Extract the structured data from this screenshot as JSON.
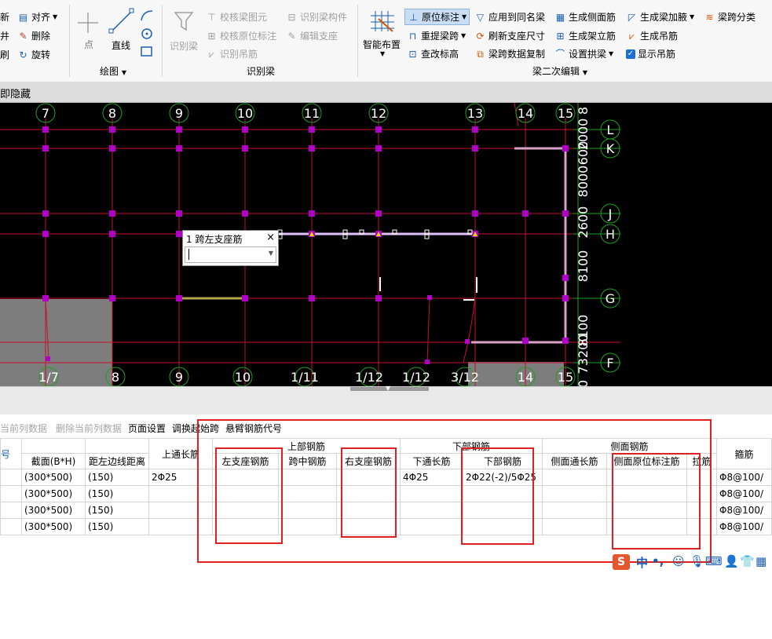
{
  "ribbon": {
    "left_col": [
      "新",
      "井",
      "刷"
    ],
    "align_label": "对齐",
    "delete_label": "删除",
    "rotate_label": "旋转",
    "point_label": "点",
    "line_label": "直线",
    "draw_group": "绘图",
    "recognize_beam": "识别梁",
    "check_beam_element": "校核梁图元",
    "check_origin_label": "校核原位标注",
    "recognize_hanging": "识别吊筋",
    "recognize_beam_member": "识别梁构件",
    "edit_support": "编辑支座",
    "recognize_group": "识别梁",
    "smart_layout": "智能布置",
    "origin_label": "原位标注",
    "lift_span": "重提梁跨",
    "check_elevation": "查改标高",
    "apply_same_name": "应用到同名梁",
    "refresh_support": "刷新支座尺寸",
    "copy_span_data": "梁跨数据复制",
    "gen_side_bar": "生成侧面筋",
    "gen_stirrup_leg": "生成架立筋",
    "set_arch": "设置拱梁",
    "gen_haunch": "生成梁加腋",
    "gen_hanging": "生成吊筋",
    "show_hanging": "显示吊筋",
    "span_classify": "梁跨分类",
    "secondary_edit_group": "梁二次编辑"
  },
  "statusbar_text": "即隐藏",
  "cad": {
    "top_axes": [
      "7",
      "8",
      "9",
      "10",
      "11",
      "12",
      "13",
      "14",
      "15"
    ],
    "bottom_axes": [
      "1/7",
      "8",
      "9",
      "10",
      "1/11",
      "1/12",
      "1/12",
      "3/12",
      "14",
      "15"
    ],
    "right_axes": [
      "L",
      "K",
      "J",
      "H",
      "G",
      "F"
    ],
    "right_dims": [
      "8",
      "2000",
      "600",
      "8000",
      "2600",
      "8100",
      "8100",
      "73200",
      "0"
    ]
  },
  "popup": {
    "title": "1 跨左支座筋",
    "close": "×",
    "input_value": ""
  },
  "toolbar": {
    "items": [
      "当前列数据",
      "删除当前列数据",
      "页面设置",
      "调换起始跨",
      "悬臂钢筋代号"
    ]
  },
  "table": {
    "col_no": "号",
    "col_section": "截面(B*H)",
    "col_offset": "距左边线距离",
    "col_top_through": "上通长筋",
    "group_top": "上部钢筋",
    "col_left_support": "左支座钢筋",
    "col_mid_span": "跨中钢筋",
    "col_right_support": "右支座钢筋",
    "group_bottom": "下部钢筋",
    "col_bottom_through": "下通长筋",
    "col_bottom_bar": "下部钢筋",
    "group_side": "侧面钢筋",
    "col_side_through": "侧面通长筋",
    "col_side_origin": "侧面原位标注筋",
    "col_tie": "拉筋",
    "col_stirrup": "箍筋",
    "rows": [
      {
        "section": "(300*500)",
        "offset": "(150)",
        "top_through": "2Φ25",
        "bottom_through": "4Φ25",
        "bottom_bar": "2Φ22(-2)/5Φ25",
        "stirrup": "Φ8@100/"
      },
      {
        "section": "(300*500)",
        "offset": "(150)",
        "top_through": "",
        "bottom_through": "",
        "bottom_bar": "",
        "stirrup": "Φ8@100/"
      },
      {
        "section": "(300*500)",
        "offset": "(150)",
        "top_through": "",
        "bottom_through": "",
        "bottom_bar": "",
        "stirrup": "Φ8@100/"
      },
      {
        "section": "(300*500)",
        "offset": "(150)",
        "top_through": "",
        "bottom_through": "",
        "bottom_bar": "",
        "stirrup": "Φ8@100/"
      }
    ]
  },
  "ime": {
    "lang": "中",
    "punct": "•,"
  },
  "colors": {
    "grid_line": "#c8102e",
    "node": "#b000c8",
    "axis_circle": "#1fa01f",
    "highlight_box": "#e02020"
  }
}
